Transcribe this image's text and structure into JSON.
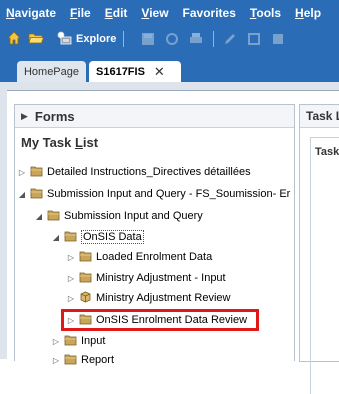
{
  "menu": [
    {
      "label": "Navigate",
      "key": "N",
      "rest": "avigate"
    },
    {
      "label": "File",
      "key": "F",
      "rest": "ile"
    },
    {
      "label": "Edit",
      "key": "E",
      "rest": "dit"
    },
    {
      "label": "View",
      "key": "V",
      "rest": "iew"
    },
    {
      "label": "Favorites",
      "key": "",
      "rest": "Favorites"
    },
    {
      "label": "Tools",
      "key": "T",
      "rest": "ools"
    },
    {
      "label": "Help",
      "key": "H",
      "rest": "elp"
    }
  ],
  "toolbar": {
    "explore_label": "Explore"
  },
  "tabs": {
    "home": "HomePage",
    "active": "S1617FIS",
    "close": "✕"
  },
  "left_panel": {
    "forms_label": "Forms",
    "task_list_prefix": "My Task ",
    "task_list_key": "L",
    "task_list_suffix": "ist"
  },
  "tree": [
    {
      "label": "Detailed Instructions_Directives détaillées",
      "expanded": false
    },
    {
      "label": "Submission Input and Query - FS_Soumission- Er",
      "expanded": true
    },
    {
      "label": "Submission Input and Query",
      "expanded": true
    },
    {
      "label": "OnSIS Data",
      "expanded": true
    },
    {
      "label": "Loaded Enrolment Data",
      "expanded": false
    },
    {
      "label": "Ministry Adjustment - Input",
      "expanded": false
    },
    {
      "label": "Ministry Adjustment Review",
      "expanded": false
    },
    {
      "label": "OnSIS Enrolment Data Review",
      "expanded": false
    },
    {
      "label": "Input",
      "expanded": false
    },
    {
      "label": "Report",
      "expanded": false
    }
  ],
  "right_panel": {
    "header": "Task Li",
    "sub_header": "Task L"
  },
  "colors": {
    "chrome_blue": "#2a6cb5",
    "highlight_red": "#e01818",
    "folder_tan": "#c8a55a"
  }
}
